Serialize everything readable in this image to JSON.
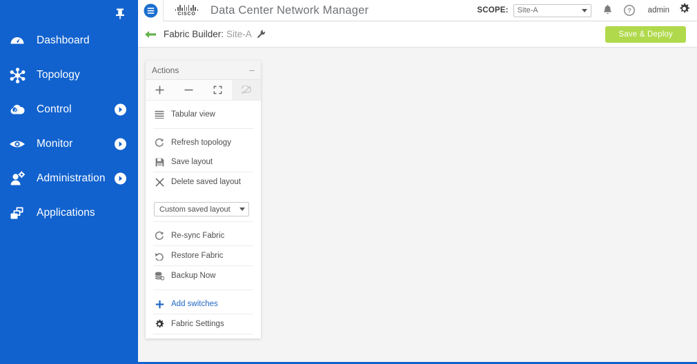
{
  "colors": {
    "sidebar_blue": "#1162ce",
    "link_blue": "#2066c4",
    "save_deploy_green": "#b0d94b",
    "canvas_grey": "#f4f4f4",
    "panel_white": "#ffffff"
  },
  "sidebar": {
    "pin_icon": "pin-icon",
    "items": [
      {
        "label": "Dashboard",
        "icon": "dashboard-gauge-icon",
        "has_arrow": false
      },
      {
        "label": "Topology",
        "icon": "topology-nodes-icon",
        "has_arrow": false
      },
      {
        "label": "Control",
        "icon": "control-cloud-icon",
        "has_arrow": true
      },
      {
        "label": "Monitor",
        "icon": "monitor-eye-icon",
        "has_arrow": true
      },
      {
        "label": "Administration",
        "icon": "admin-user-gear-icon",
        "has_arrow": true
      },
      {
        "label": "Applications",
        "icon": "applications-windows-icon",
        "has_arrow": false
      }
    ]
  },
  "header": {
    "menu_icon": "hamburger-menu-icon",
    "brand": "CISCO",
    "title": "Data Center Network Manager",
    "scope_label": "SCOPE:",
    "scope_value": "Site-A",
    "scope_options": [
      "Site-A"
    ],
    "alerts_icon": "bell-icon",
    "help_icon": "help-question-icon",
    "user": "admin",
    "settings_icon": "gear-icon"
  },
  "subheader": {
    "back_icon": "back-arrow-icon",
    "title_prefix": "Fabric Builder:",
    "fabric_name": "Site-A",
    "edit_icon": "wrench-icon",
    "save_deploy_label": "Save & Deploy"
  },
  "actions_panel": {
    "title": "Actions",
    "collapse_icon": "minimize-icon",
    "toolbar": [
      {
        "name": "zoom-in-button",
        "glyph": "+",
        "disabled": false
      },
      {
        "name": "zoom-out-button",
        "glyph": "−",
        "disabled": false
      },
      {
        "name": "fit-screen-button",
        "glyph": "fit-screen-icon",
        "disabled": false
      },
      {
        "name": "overlay-toggle-button",
        "glyph": "crossed-overlay-icon",
        "disabled": true
      }
    ],
    "groups": [
      {
        "items": [
          {
            "label": "Tabular view",
            "icon": "list-lines-icon",
            "style": "normal"
          }
        ]
      },
      {
        "items": [
          {
            "label": "Refresh topology",
            "icon": "refresh-circular-icon",
            "style": "normal"
          },
          {
            "label": "Save layout",
            "icon": "floppy-disk-icon",
            "style": "normal"
          },
          {
            "label": "Delete saved layout",
            "icon": "close-x-icon",
            "style": "normal"
          }
        ]
      },
      {
        "select": {
          "name": "saved-layout-select",
          "value": "Custom saved layout",
          "options": [
            "Custom saved layout"
          ]
        }
      },
      {
        "items": [
          {
            "label": "Re-sync Fabric",
            "icon": "resync-circular-icon",
            "style": "normal"
          },
          {
            "label": "Restore Fabric",
            "icon": "undo-arrow-icon",
            "style": "normal"
          },
          {
            "label": "Backup Now",
            "icon": "backup-database-icon",
            "style": "normal"
          }
        ]
      },
      {
        "items": [
          {
            "label": "Add switches",
            "icon": "plus-icon",
            "style": "link"
          },
          {
            "label": "Fabric Settings",
            "icon": "gear-icon",
            "style": "dark"
          }
        ]
      }
    ]
  }
}
